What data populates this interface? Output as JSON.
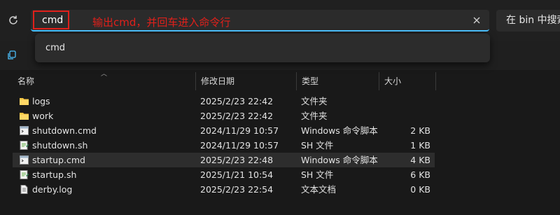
{
  "address_bar": {
    "value": "cmd",
    "annotation": "输出cmd，并回车进入命令行"
  },
  "search": {
    "placeholder": "在 bin 中搜索"
  },
  "dropdown": {
    "items": [
      "cmd"
    ]
  },
  "columns": {
    "name": "名称",
    "date": "修改日期",
    "type": "类型",
    "size": "大小"
  },
  "files": [
    {
      "name": "logs",
      "date": "2025/2/23 22:42",
      "type": "文件夹",
      "size": "",
      "icon": "folder-icon"
    },
    {
      "name": "work",
      "date": "2025/2/23 22:42",
      "type": "文件夹",
      "size": "",
      "icon": "folder-icon"
    },
    {
      "name": "shutdown.cmd",
      "date": "2024/11/29 10:57",
      "type": "Windows 命令脚本",
      "size": "2 KB",
      "icon": "cmd-file-icon"
    },
    {
      "name": "shutdown.sh",
      "date": "2024/11/29 10:57",
      "type": "SH 文件",
      "size": "1 KB",
      "icon": "script-file-icon"
    },
    {
      "name": "startup.cmd",
      "date": "2025/2/23 22:48",
      "type": "Windows 命令脚本",
      "size": "4 KB",
      "icon": "cmd-file-icon"
    },
    {
      "name": "startup.sh",
      "date": "2025/1/21 10:54",
      "type": "SH 文件",
      "size": "6 KB",
      "icon": "script-file-icon"
    },
    {
      "name": "derby.log",
      "date": "2025/2/23 22:54",
      "type": "文本文档",
      "size": "0 KB",
      "icon": "text-file-icon"
    }
  ],
  "colors": {
    "accent": "#4cc2ff",
    "annotation_red": "#e0201b",
    "folder": "#f4c542"
  }
}
